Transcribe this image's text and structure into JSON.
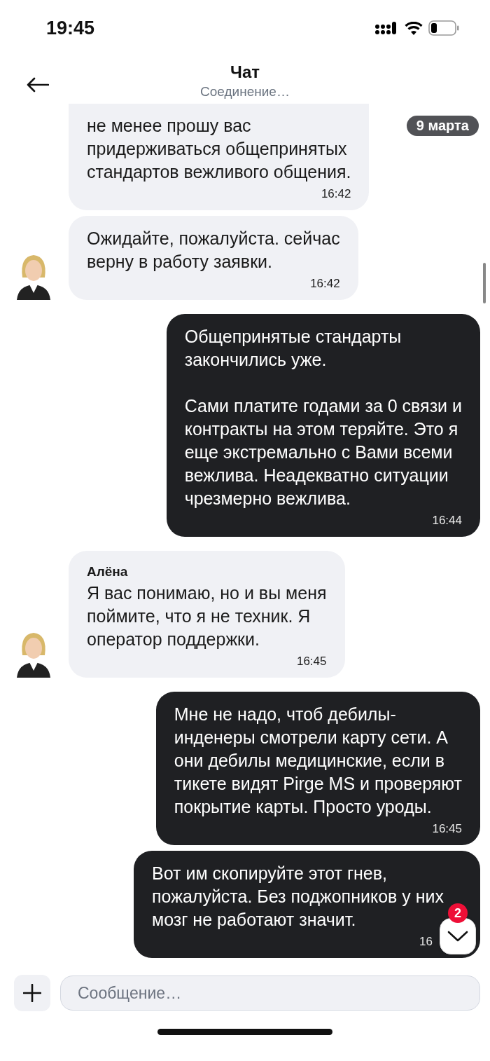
{
  "status_bar": {
    "time": "19:45"
  },
  "header": {
    "title": "Чат",
    "subtitle": "Соединение…"
  },
  "date_label": "9 марта",
  "messages": [
    {
      "kind": "incoming",
      "avatar": false,
      "text": "не менее прошу вас\nпридерживаться общепринятых\nстандартов вежливого общения.",
      "time": "16:42"
    },
    {
      "kind": "incoming",
      "avatar": true,
      "text": "Ожидайте, пожалуйста. сейчас\nверну в работу заявки.",
      "time": "16:42"
    },
    {
      "kind": "outgoing",
      "text": "Общепринятые стандарты\nзакончились уже.\n\nСами платите годами за 0 связи и\nконтракты на этом теряйте. Это я\nеще экстремально с Вами всеми\nвежлива. Неадекватно ситуации\nчрезмерно вежлива.",
      "time": "16:44"
    },
    {
      "kind": "incoming",
      "avatar": true,
      "sender": "Алёна",
      "text": "Я вас понимаю, но и вы меня\nпоймите, что я не техник. Я\nоператор поддержки.",
      "time": "16:45"
    },
    {
      "kind": "outgoing",
      "text": "Мне не надо, чтоб дебилы-\nинденеры смотрели карту сети. А\nони дебилы медицинские, если в\nтикете видят Pirge MS и проверяют\nпокрытие карты. Просто уроды.",
      "time": "16:45"
    },
    {
      "kind": "outgoing",
      "text": "Вот им скопируйте этот гнев,\nпожалуйста. Без поджопников у них\nмозг не работают значит.",
      "time": "16"
    }
  ],
  "scroll_button": {
    "badge": "2"
  },
  "composer": {
    "placeholder": "Сообщение…"
  }
}
